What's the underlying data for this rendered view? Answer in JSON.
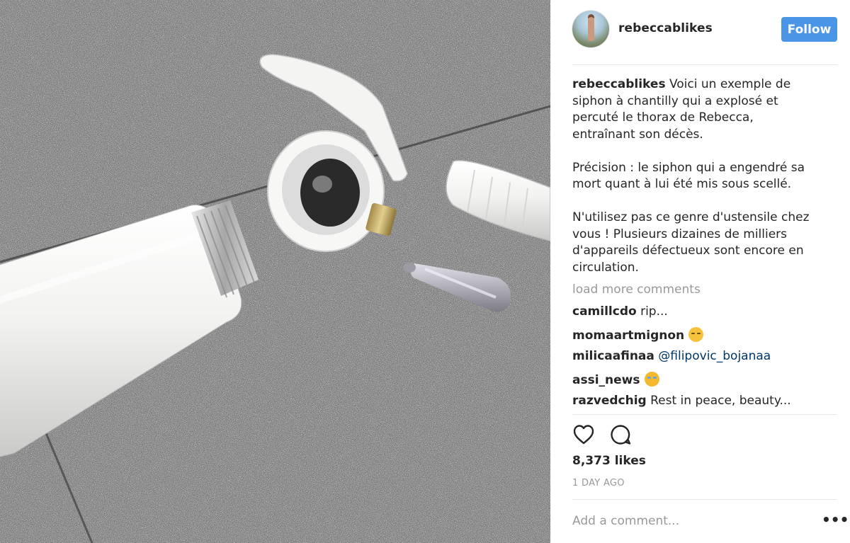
{
  "post": {
    "username": "rebeccablikes",
    "follow_label": "Follow",
    "caption_user": "rebeccablikes",
    "caption_text": " Voici un exemple de\nsiphon à chantilly qui a explosé et\npercuté le thorax de Rebecca,\nentraînant son décès.\n\nPrécision : le siphon qui a engendré sa\nmort quant à lui été mis sous scellé.\n\nN'utilisez pas ce genre d'ustensile chez\nvous ! Plusieurs dizaines de milliers\nd'appareils défectueux sont encore en\ncirculation.",
    "load_more": "load more comments",
    "comments": [
      {
        "user": "camillcdo",
        "text": " rip..."
      },
      {
        "user": "momaartmignon",
        "text": " ",
        "emoji": "pensive-face-icon"
      },
      {
        "user": "milicaafinaa",
        "text": " ",
        "mention": "@filipovic_bojanaa"
      },
      {
        "user": "assi_news",
        "text": " ",
        "emoji": "crying-face-icon"
      },
      {
        "user": "razvedchig",
        "text": " Rest in peace, beauty..."
      }
    ],
    "likes": "8,373 likes",
    "time": "1 DAY AGO",
    "add_comment_placeholder": "Add a comment...",
    "more_label": "•••"
  },
  "icons": {
    "like": "heart-icon",
    "comment": "comment-bubble-icon",
    "more": "more-options-icon"
  },
  "colors": {
    "follow_button": "#4a95e6",
    "mention": "#003569",
    "muted_text": "#999999"
  }
}
